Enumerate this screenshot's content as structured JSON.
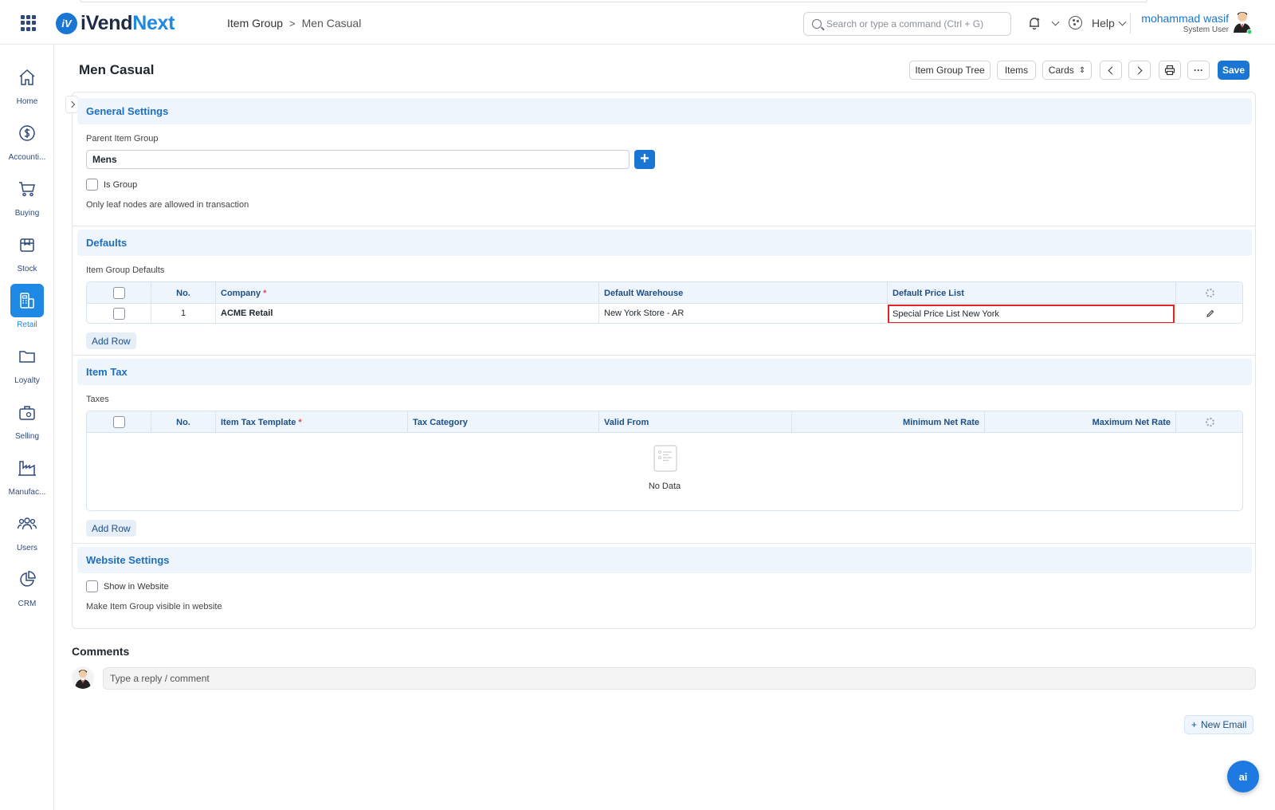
{
  "app": {
    "logo_mark": "iV",
    "logo_a": "iVend",
    "logo_b": "Next"
  },
  "breadcrumb": {
    "parent": "Item Group",
    "separator": ">",
    "current": "Men Casual"
  },
  "search": {
    "placeholder": "Search or type a command (Ctrl + G)"
  },
  "header": {
    "help_label": "Help",
    "user_name": "mohammad wasif",
    "user_role": "System User"
  },
  "sidebar": {
    "items": [
      {
        "label": "Home",
        "icon": "home-icon"
      },
      {
        "label": "Accounti...",
        "icon": "dollar-icon"
      },
      {
        "label": "Buying",
        "icon": "cart-icon"
      },
      {
        "label": "Stock",
        "icon": "box-icon"
      },
      {
        "label": "Retail",
        "icon": "pos-icon",
        "active": true
      },
      {
        "label": "Loyalty",
        "icon": "folder-icon"
      },
      {
        "label": "Selling",
        "icon": "bag-icon"
      },
      {
        "label": "Manufac...",
        "icon": "factory-icon"
      },
      {
        "label": "Users",
        "icon": "users-icon"
      },
      {
        "label": "CRM",
        "icon": "pie-icon"
      }
    ]
  },
  "page": {
    "title": "Men Casual",
    "toolbar": {
      "item_group_tree": "Item Group Tree",
      "items": "Items",
      "cards": "Cards",
      "cards_caret": "⇕",
      "more": "···",
      "save": "Save"
    }
  },
  "general": {
    "title": "General Settings",
    "parent_label": "Parent Item Group",
    "parent_value": "Mens",
    "plus": "+",
    "is_group_label": "Is Group",
    "is_group_checked": false,
    "help": "Only leaf nodes are allowed in transaction"
  },
  "defaults": {
    "title": "Defaults",
    "table_label": "Item Group Defaults",
    "columns": {
      "no": "No.",
      "company": "Company",
      "warehouse": "Default Warehouse",
      "price_list": "Default Price List"
    },
    "required_mark": "*",
    "rows": [
      {
        "no": "1",
        "company": "ACME Retail",
        "warehouse": "New York Store - AR",
        "price_list": "Special Price List New York"
      }
    ],
    "add_row": "Add Row"
  },
  "item_tax": {
    "title": "Item Tax",
    "table_label": "Taxes",
    "columns": {
      "no": "No.",
      "template": "Item Tax Template",
      "category": "Tax Category",
      "valid_from": "Valid From",
      "min_rate": "Minimum Net Rate",
      "max_rate": "Maximum Net Rate"
    },
    "required_mark": "*",
    "empty": "No Data",
    "add_row": "Add Row"
  },
  "website": {
    "title": "Website Settings",
    "show_label": "Show in Website",
    "show_checked": false,
    "help": "Make Item Group visible in website"
  },
  "comments": {
    "title": "Comments",
    "placeholder": "Type a reply / comment",
    "new_email": "New Email",
    "new_email_plus": "+"
  },
  "ai_button": "ai",
  "colors": {
    "primary": "#1976d2",
    "section_bg": "#eef5fc",
    "section_title": "#1e6fbf",
    "highlight": "#e02424"
  }
}
